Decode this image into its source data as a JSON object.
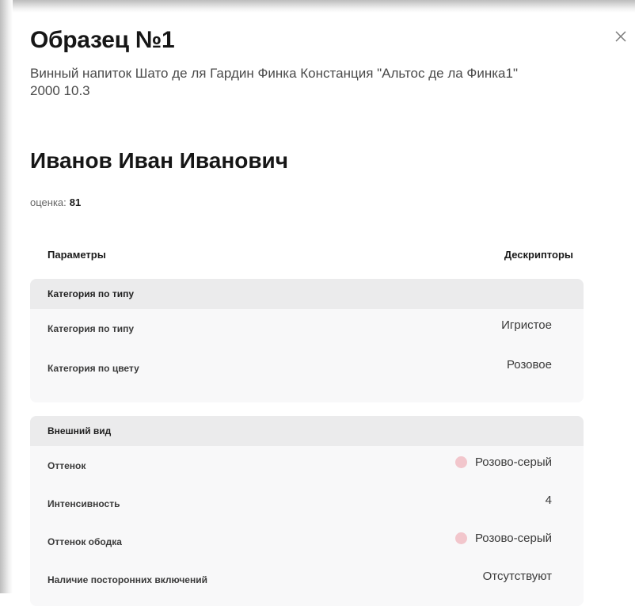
{
  "modal": {
    "title": "Образец №1",
    "subtitle": "Винный напиток Шато де ля Гардин Финка Констанция \"Альтос де ла Финка1\" 2000 10.3",
    "close_icon": "close-icon"
  },
  "assessor": {
    "name": "Иванов Иван Иванович",
    "score_label": "оценка:",
    "score_value": "81"
  },
  "table": {
    "param_header": "Параметры",
    "descriptor_header": "Дескрипторы"
  },
  "sections": [
    {
      "title": "Категория по типу",
      "rows": [
        {
          "label": "Категория по типу",
          "value": "Игристое"
        },
        {
          "label": "Категория по цвету",
          "value": "Розовое"
        }
      ]
    },
    {
      "title": "Внешний вид",
      "rows": [
        {
          "label": "Оттенок",
          "value": "Розово-серый",
          "swatch_color": "#f2c6cc"
        },
        {
          "label": "Интенсивность",
          "value": "4"
        },
        {
          "label": "Оттенок ободка",
          "value": "Розово-серый",
          "swatch_color": "#f2c6cc"
        },
        {
          "label": "Наличие посторонних включений",
          "value": "Отсутствуют"
        }
      ]
    }
  ]
}
